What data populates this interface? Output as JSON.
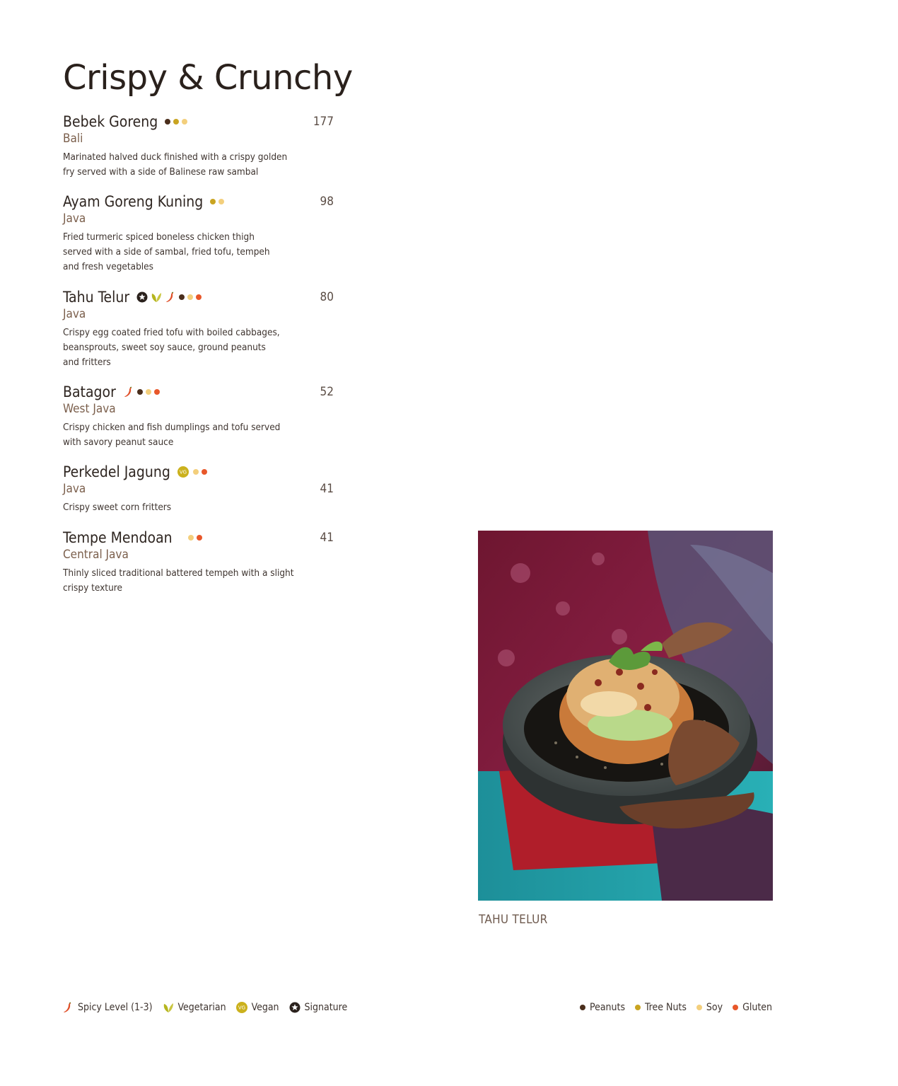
{
  "page": {
    "title": "Crispy & Crunchy"
  },
  "items": [
    {
      "name": "Bebek Goreng",
      "region": "Bali",
      "price": "177",
      "description_lines": [
        "Marinated halved duck finished with a crispy golden",
        "fry served with a side of Balinese raw sambal"
      ],
      "badges": [
        "peanuts-dot",
        "tree-nuts-dot",
        "soy-dot"
      ]
    },
    {
      "name": "Ayam Goreng Kuning",
      "region": "Java",
      "price": "98",
      "description_lines": [
        "Fried turmeric spiced boneless chicken thigh",
        "served with a side of sambal, fried tofu, tempeh",
        "and fresh vegetables"
      ],
      "badges": [
        "tree-nuts-dot",
        "soy-dot"
      ]
    },
    {
      "name": "Tahu Telur",
      "region": "Java",
      "price": "80",
      "description_lines": [
        "Crispy egg coated fried tofu with boiled cabbages,",
        "beansprouts, sweet soy sauce, ground peanuts",
        "and fritters"
      ],
      "badges": [
        "signature-icon",
        "vegetarian-icon",
        "chili-icon",
        "peanuts-dot",
        "soy-dot",
        "gluten-dot"
      ]
    },
    {
      "name": "Batagor",
      "region": "West Java",
      "price": "52",
      "description_lines": [
        "Crispy chicken and fish dumplings and tofu served",
        "with savory peanut sauce"
      ],
      "badges": [
        "chili-icon",
        "peanuts-dot",
        "soy-dot",
        "gluten-dot"
      ]
    },
    {
      "name": "Perkedel Jagung",
      "region": "Java",
      "price": "41",
      "description_lines": [
        "Crispy sweet corn fritters"
      ],
      "badges": [
        "vegan-icon",
        "soy-dot",
        "gluten-dot"
      ]
    },
    {
      "name": "Tempe Mendoan",
      "region": "Central Java",
      "price": "41",
      "description_lines": [
        "Thinly sliced traditional battered tempeh with a slight",
        "crispy texture"
      ],
      "badges": [
        "soy-dot",
        "gluten-dot"
      ]
    }
  ],
  "photo": {
    "caption": "TAHU TELUR"
  },
  "legend": {
    "symbols": [
      {
        "icon": "chili-icon",
        "label": "Spicy Level (1-3)"
      },
      {
        "icon": "vegetarian-icon",
        "label": "Vegetarian"
      },
      {
        "icon": "vegan-icon",
        "label": "Vegan",
        "icon_text": "VG"
      },
      {
        "icon": "signature-icon",
        "label": "Signature"
      }
    ],
    "allergens": [
      {
        "icon": "peanuts-dot",
        "label": "Peanuts"
      },
      {
        "icon": "tree-nuts-dot",
        "label": "Tree Nuts"
      },
      {
        "icon": "soy-dot",
        "label": "Soy"
      },
      {
        "icon": "gluten-dot",
        "label": "Gluten"
      }
    ]
  },
  "colors": {
    "peanuts": "#4a2e1c",
    "tree_nuts": "#c9a421",
    "soy": "#f3cf7c",
    "gluten": "#e8572a",
    "chili": "#e0502a",
    "leaf": "#b5b51e",
    "vegan": "#cbb11d",
    "signature": "#2a211c"
  }
}
